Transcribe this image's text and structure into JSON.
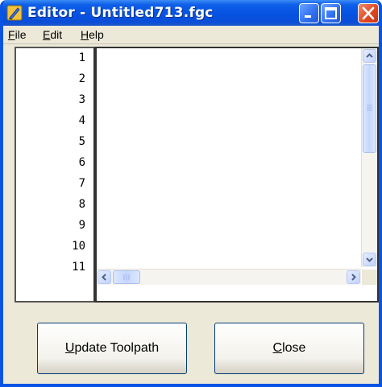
{
  "window": {
    "title": "Editor - Untitled713.fgc",
    "colors": {
      "titlebar": "#0652e2",
      "frame": "#0a54e4",
      "face": "#ece9d8",
      "close": "#e0461f"
    }
  },
  "menu": {
    "items": [
      {
        "mnemonic": "F",
        "rest": "ile"
      },
      {
        "mnemonic": "E",
        "rest": "dit"
      },
      {
        "mnemonic": "H",
        "rest": "elp"
      }
    ]
  },
  "gutter": {
    "line_numbers": [
      "1",
      "2",
      "3",
      "4",
      "5",
      "6",
      "7",
      "8",
      "9",
      "10",
      "11"
    ]
  },
  "editor": {
    "content": ""
  },
  "buttons": {
    "update": {
      "mnemonic": "U",
      "rest": "pdate Toolpath"
    },
    "close": {
      "mnemonic": "C",
      "rest": "lose"
    }
  },
  "icons": {
    "app": "pencil-document-icon",
    "minimize": "minimize-icon",
    "maximize": "maximize-icon",
    "close": "close-icon"
  }
}
